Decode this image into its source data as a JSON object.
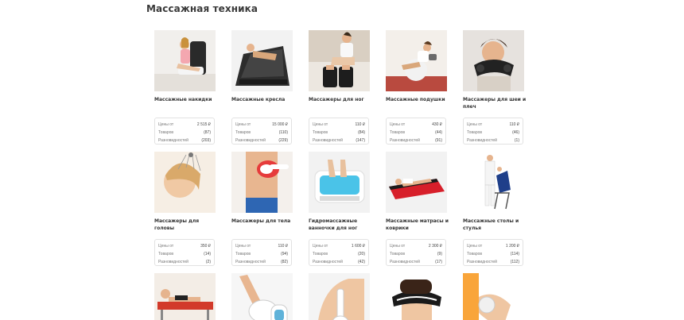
{
  "page": {
    "title": "Массажная техника"
  },
  "stat_labels": {
    "price": "Цены от",
    "goods": "Товаров",
    "variants": "Разновидностей"
  },
  "cards": [
    {
      "title": "Массажные накидки",
      "price": "2 515 ₽",
      "goods": "(87)",
      "variants": "(203)",
      "image": "woman-in-black-chair"
    },
    {
      "title": "Массажные кресла",
      "price": "15 000 ₽",
      "goods": "(110)",
      "variants": "(229)",
      "image": "woman-in-massage-chair"
    },
    {
      "title": "Массажеры для ног",
      "price": "110 ₽",
      "goods": "(84)",
      "variants": "(147)",
      "image": "foot-massager"
    },
    {
      "title": "Массажные подушки",
      "price": "430 ₽",
      "goods": "(44)",
      "variants": "(91)",
      "image": "woman-with-pillow"
    },
    {
      "title": "Массажеры для шеи и плеч",
      "price": "110 ₽",
      "goods": "(46)",
      "variants": "(1)",
      "image": "neck-massager"
    },
    {
      "title": "Массажеры для головы",
      "price": "350 ₽",
      "goods": "(14)",
      "variants": "(2)",
      "image": "head-massager"
    },
    {
      "title": "Массажеры для тела",
      "price": "110 ₽",
      "goods": "(94)",
      "variants": "(82)",
      "image": "body-massager"
    },
    {
      "title": "Гидромассажные ванночки для ног",
      "price": "1 600 ₽",
      "goods": "(20)",
      "variants": "(42)",
      "image": "foot-spa"
    },
    {
      "title": "Массажные матрасы и коврики",
      "price": "2 300 ₽",
      "goods": "(9)",
      "variants": "(17)",
      "image": "massage-mat"
    },
    {
      "title": "Массажные столы и стулья",
      "price": "1 200 ₽",
      "goods": "(114)",
      "variants": "(112)",
      "image": "massage-chair-table"
    },
    {
      "title": "",
      "price": "",
      "goods": "",
      "variants": "",
      "image": "woman-on-massage-bed"
    },
    {
      "title": "",
      "price": "",
      "goods": "",
      "variants": "",
      "image": "handheld-massager"
    },
    {
      "title": "",
      "price": "",
      "goods": "",
      "variants": "",
      "image": "woman-back-massager"
    },
    {
      "title": "",
      "price": "",
      "goods": "",
      "variants": "",
      "image": "eye-massager"
    },
    {
      "title": "",
      "price": "",
      "goods": "",
      "variants": "",
      "image": "arm-massager"
    }
  ]
}
